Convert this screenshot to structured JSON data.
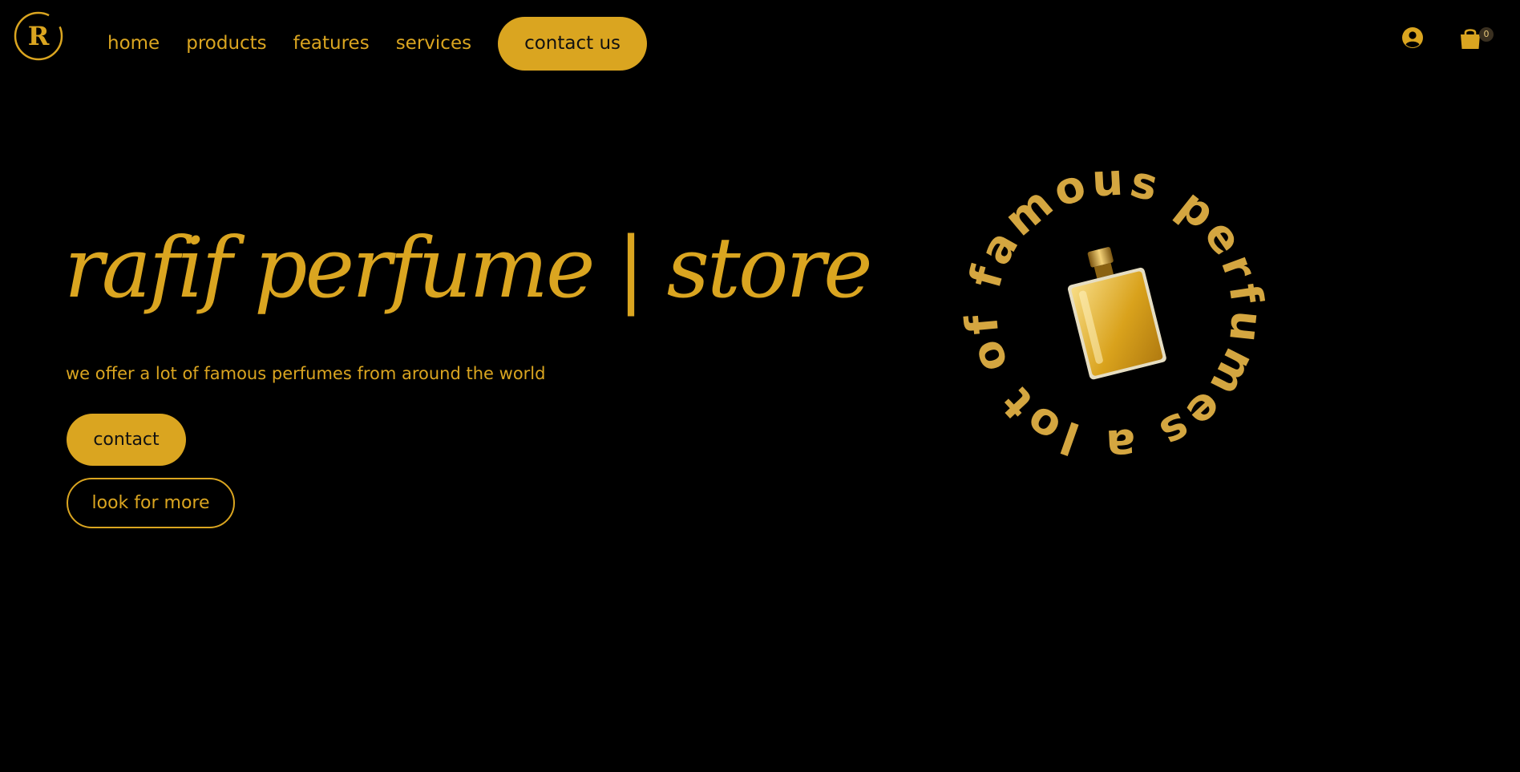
{
  "brand": {
    "logo_letter": "R",
    "accent_color": "#daa520",
    "background_color": "#000000"
  },
  "nav": {
    "items": [
      {
        "label": "home"
      },
      {
        "label": "products"
      },
      {
        "label": "features"
      },
      {
        "label": "services"
      }
    ],
    "contact_label": "contact us"
  },
  "header_icons": {
    "user_icon": "user-circle-icon",
    "cart_icon": "shopping-bag-icon",
    "cart_count": "0"
  },
  "hero": {
    "title": "rafif perfume | store",
    "subtitle": "we offer a lot of famous perfumes from around the world",
    "primary_button": "contact",
    "secondary_button": "look for more"
  },
  "badge": {
    "ring_text": "a lot of famous perfumes",
    "center_image": "perfume-bottle"
  }
}
